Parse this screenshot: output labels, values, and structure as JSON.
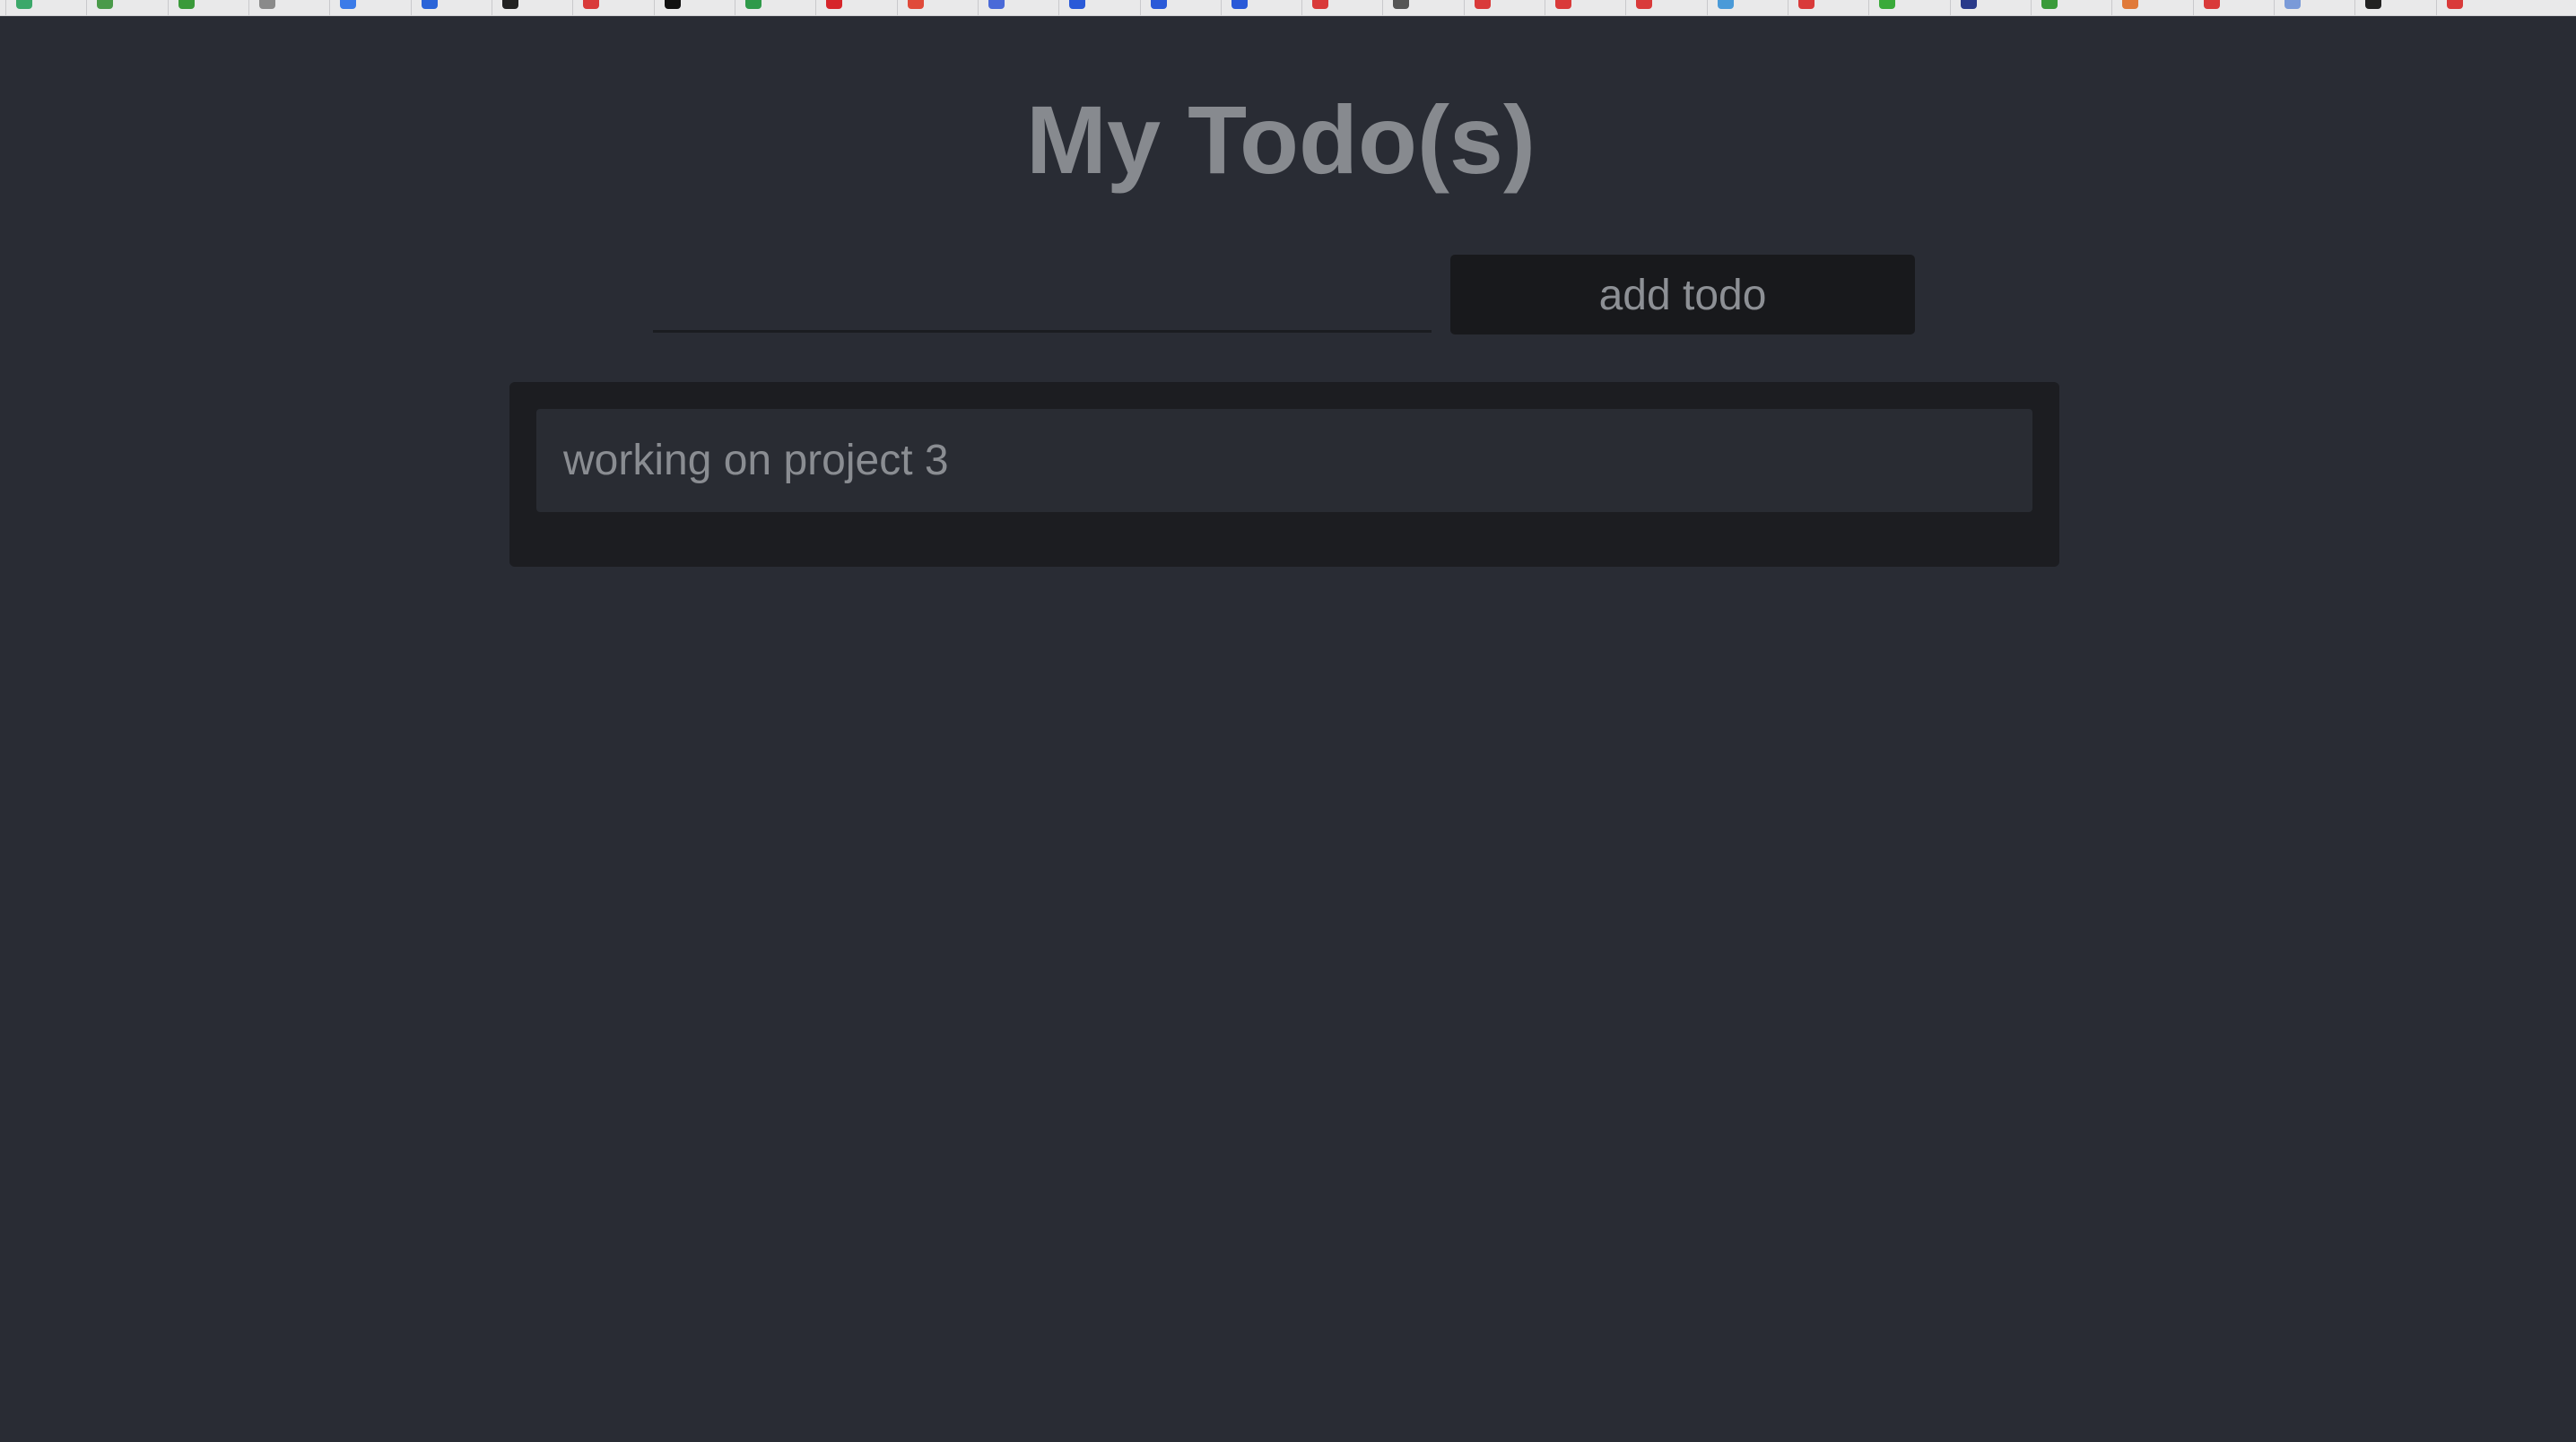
{
  "app": {
    "title": "My Todo(s)"
  },
  "form": {
    "input_value": "",
    "input_placeholder": "",
    "add_label": "add todo"
  },
  "todos": [
    {
      "text": "working on project 3"
    }
  ],
  "bookmarks_bar": {
    "icons": [
      {
        "name": "bookmark-icon",
        "color": "#3ca86a"
      },
      {
        "name": "bookmark-icon",
        "color": "#4a9a4a"
      },
      {
        "name": "bookmark-icon",
        "color": "#3a9a3a"
      },
      {
        "name": "bookmark-icon",
        "color": "#8a8a8a"
      },
      {
        "name": "bookmark-icon",
        "color": "#3b7be8"
      },
      {
        "name": "bookmark-icon",
        "color": "#2a64d8"
      },
      {
        "name": "bookmark-icon",
        "color": "#222222"
      },
      {
        "name": "bookmark-icon",
        "color": "#d93a3a"
      },
      {
        "name": "bookmark-icon",
        "color": "#111111"
      },
      {
        "name": "bookmark-icon",
        "color": "#2f9a4a"
      },
      {
        "name": "bookmark-icon",
        "color": "#d6262b"
      },
      {
        "name": "bookmark-icon",
        "color": "#e04a3a"
      },
      {
        "name": "bookmark-icon",
        "color": "#4a6ad8"
      },
      {
        "name": "bookmark-icon",
        "color": "#2a5ad8"
      },
      {
        "name": "bookmark-icon",
        "color": "#2a5ad8"
      },
      {
        "name": "bookmark-icon",
        "color": "#2a5ad8"
      },
      {
        "name": "bookmark-icon",
        "color": "#d93a3a"
      },
      {
        "name": "bookmark-icon",
        "color": "#555555"
      },
      {
        "name": "bookmark-icon",
        "color": "#d93a3a"
      },
      {
        "name": "bookmark-icon",
        "color": "#d93a3a"
      },
      {
        "name": "bookmark-icon",
        "color": "#d93a3a"
      },
      {
        "name": "bookmark-icon",
        "color": "#4a9ad8"
      },
      {
        "name": "bookmark-icon",
        "color": "#d93a3a"
      },
      {
        "name": "bookmark-icon",
        "color": "#3aaa3a"
      },
      {
        "name": "bookmark-icon",
        "color": "#2a3a8a"
      },
      {
        "name": "bookmark-icon",
        "color": "#3a9a3a"
      },
      {
        "name": "bookmark-icon",
        "color": "#e07a3a"
      },
      {
        "name": "bookmark-icon",
        "color": "#d93a3a"
      },
      {
        "name": "bookmark-icon",
        "color": "#7a9ad8"
      },
      {
        "name": "bookmark-icon",
        "color": "#222222"
      },
      {
        "name": "bookmark-icon",
        "color": "#d93a3a"
      }
    ]
  },
  "colors": {
    "background": "#292c34",
    "panel": "#1c1d21",
    "item": "#292c33",
    "button": "#18191c",
    "text": "#878a8f"
  }
}
